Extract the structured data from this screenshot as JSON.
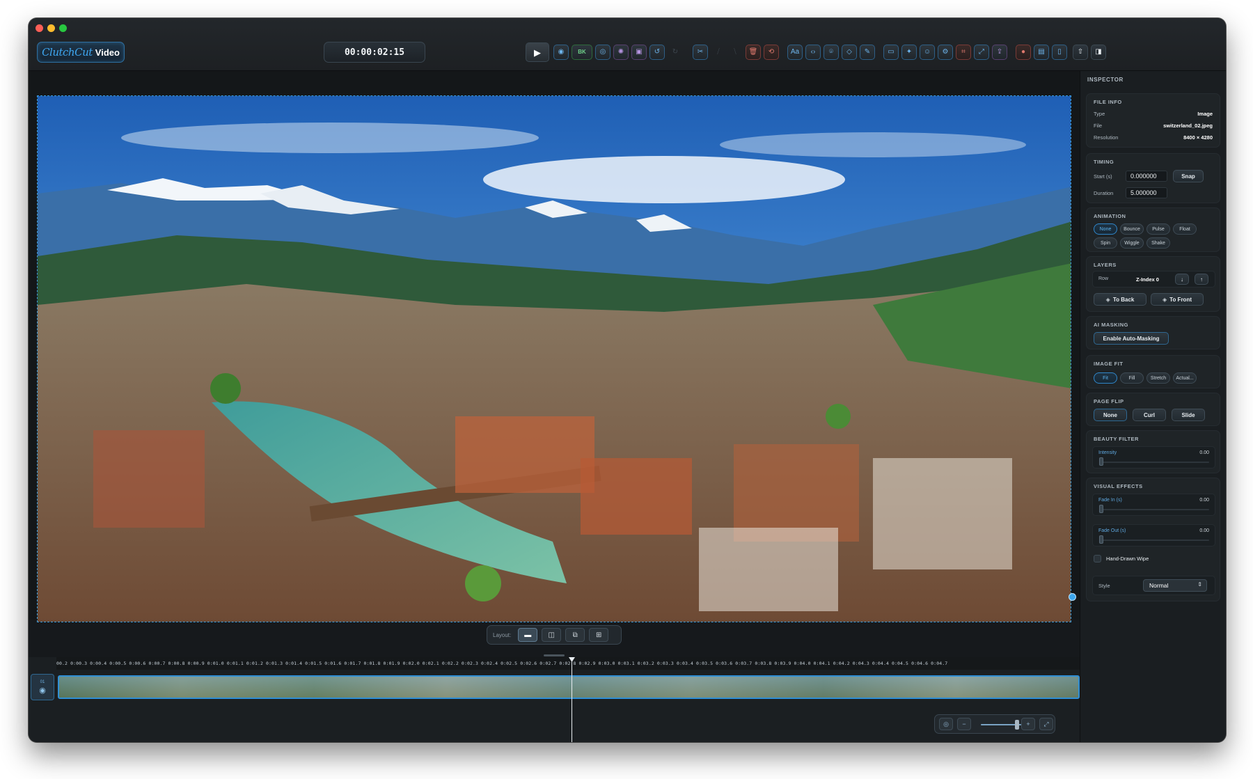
{
  "app": {
    "logo_script": "ClutchCut",
    "logo_word": "Video",
    "timecode": "00:00:02:15"
  },
  "toolbar": {
    "play_icon": "▶",
    "bk_label": "BK",
    "icons": [
      "eye-icon",
      "bk-icon",
      "target-icon",
      "sparkle-icon",
      "frame-icon",
      "undo-icon",
      "redo-icon",
      "scissors-icon",
      "split-icon",
      "trim-icon",
      "delete-icon",
      "replace-icon",
      "text-icon",
      "code-icon",
      "camera-icon",
      "shape-icon",
      "pen-icon",
      "subtitle-icon",
      "magic-icon",
      "face-icon",
      "settings-icon",
      "crop-icon",
      "transform-icon",
      "export-icon",
      "record-icon",
      "folder-icon",
      "document-icon",
      "share-icon",
      "panel-icon"
    ]
  },
  "layout_bar": {
    "label": "Layout:"
  },
  "timeline": {
    "ruler": "00.2  0:00.3  0:00.4  0:00.5  0:00.6  0:00.7  0:00.8  0:00.9  0:01.0  0:01.1  0:01.2  0:01.3  0:01.4  0:01.5  0:01.6  0:01.7  0:01.8  0:01.9  0:02.0  0:02.1  0:02.2  0:02.3  0:02.4  0:02.5  0:02.6  0:02.7  0:02.8  0:02.9  0:03.0  0:03.1  0:03.2  0:03.3  0:03.4  0:03.5  0:03.6  0:03.7  0:03.8  0:03.9  0:04.0  0:04.1  0:04.2  0:04.3  0:04.4  0:04.5  0:04.6  0:04.7",
    "track_number": "01"
  },
  "inspector": {
    "title": "INSPECTOR",
    "file_info": {
      "title": "FILE INFO",
      "type_label": "Type",
      "type_value": "Image",
      "file_label": "File",
      "file_value": "switzerland_02.jpeg",
      "res_label": "Resolution",
      "res_value": "8400 × 4280"
    },
    "timing": {
      "title": "TIMING",
      "start_label": "Start (s)",
      "start_value": "0.000000",
      "snap_label": "Snap",
      "duration_label": "Duration",
      "duration_value": "5.000000"
    },
    "animation": {
      "title": "ANIMATION",
      "options": [
        "None",
        "Bounce",
        "Pulse",
        "Float",
        "Spin",
        "Wiggle",
        "Shake"
      ],
      "selected": "None"
    },
    "layers": {
      "title": "LAYERS",
      "row_label": "Row",
      "zindex_label": "Z-Index 0",
      "to_back": "To Back",
      "to_front": "To Front"
    },
    "ai_masking": {
      "title": "AI MASKING",
      "button": "Enable Auto-Masking"
    },
    "image_fit": {
      "title": "IMAGE FIT",
      "options": [
        "Fit",
        "Fill",
        "Stretch",
        "Actual..."
      ],
      "selected": "Fit"
    },
    "page_flip": {
      "title": "PAGE FLIP",
      "options": [
        "None",
        "Curl",
        "Slide"
      ]
    },
    "beauty_filter": {
      "title": "BEAUTY FILTER",
      "intensity_label": "Intensity",
      "intensity_value": "0.00"
    },
    "visual_effects": {
      "title": "VISUAL EFFECTS",
      "fade_in_label": "Fade In (s)",
      "fade_in_value": "0.00",
      "fade_out_label": "Fade Out (s)",
      "fade_out_value": "0.00",
      "wipe_label": "Hand-Drawn Wipe",
      "style_label": "Style",
      "style_value": "Normal"
    }
  }
}
